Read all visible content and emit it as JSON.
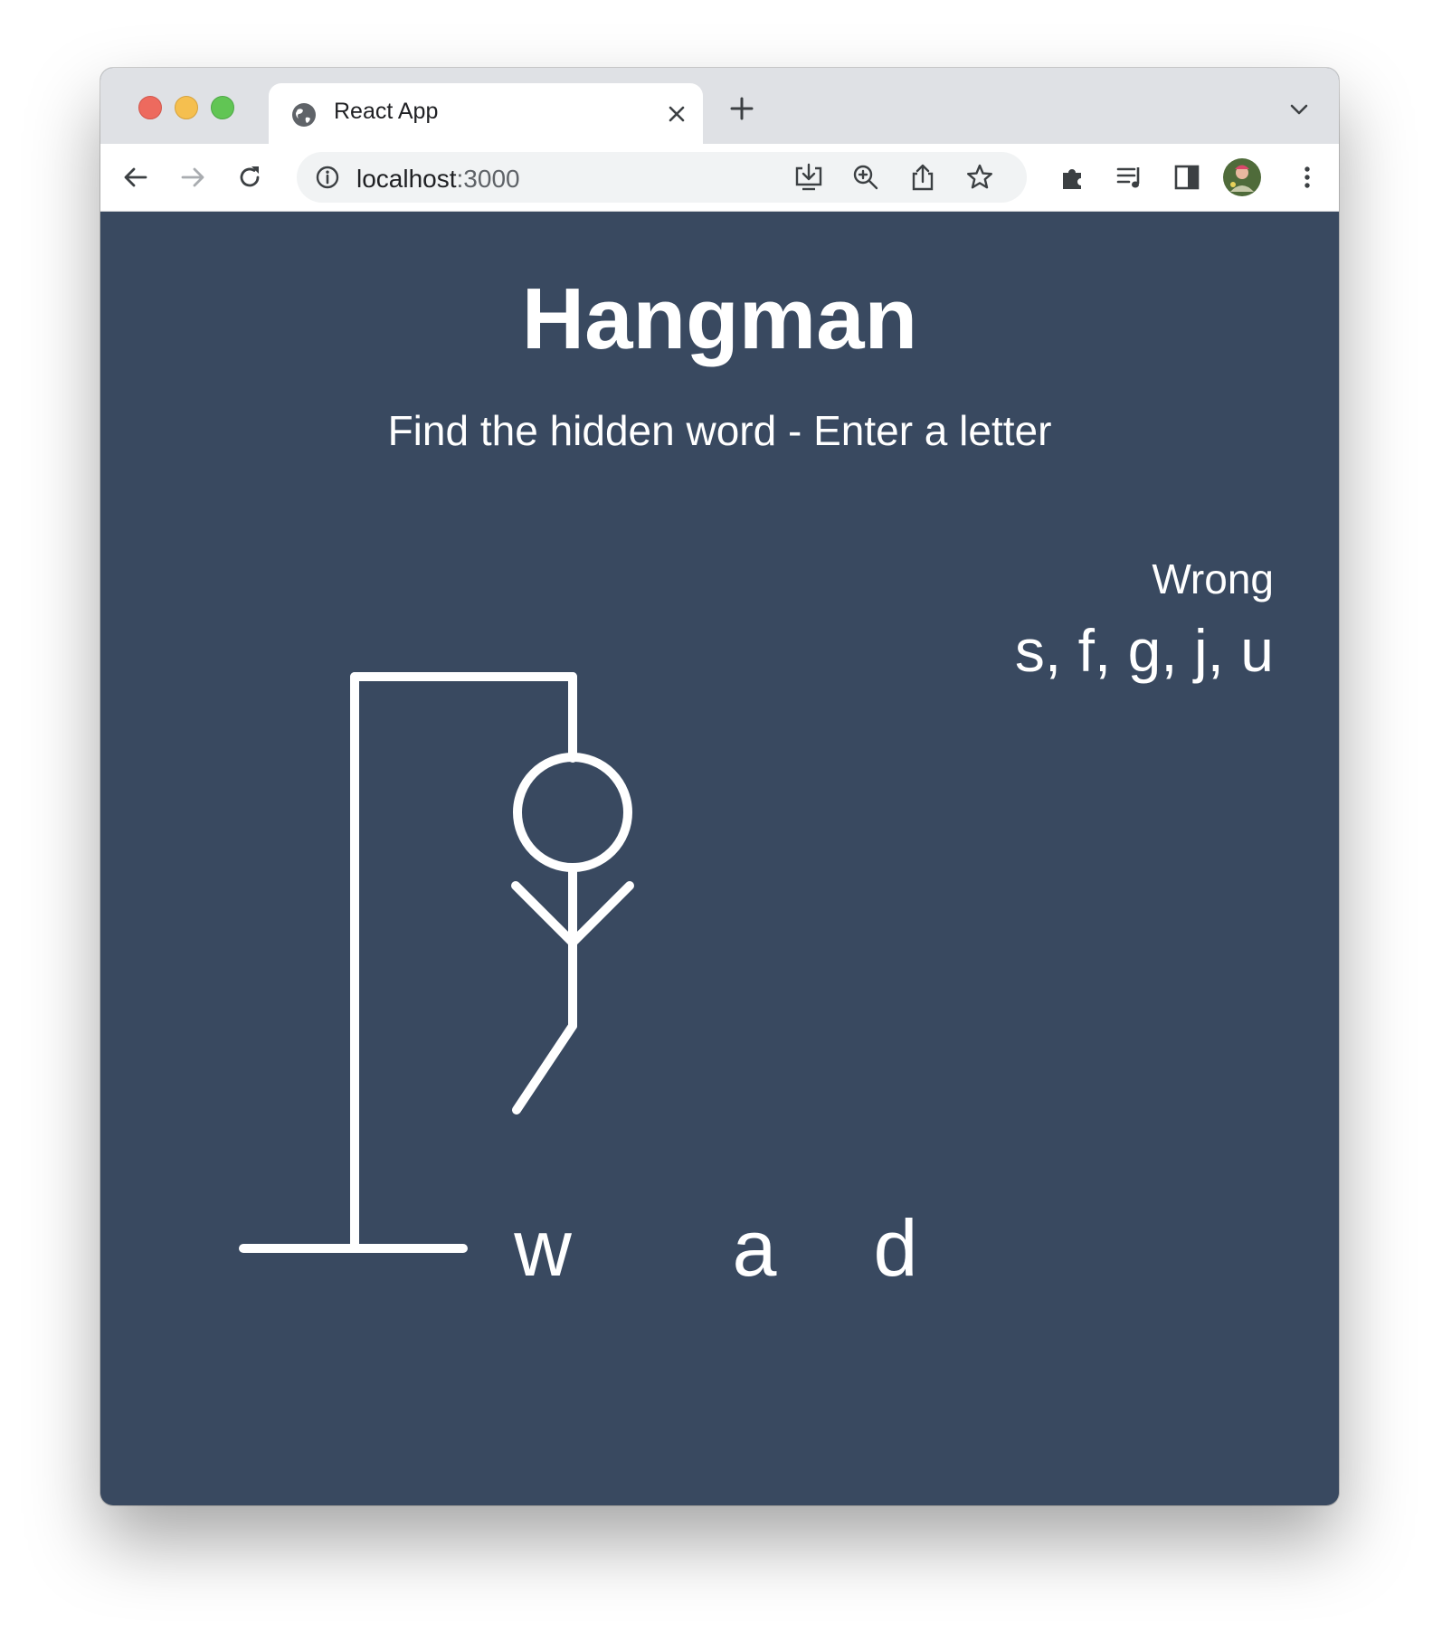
{
  "browser": {
    "tab_title": "React App",
    "url_host": "localhost",
    "url_port": ":3000"
  },
  "game": {
    "title": "Hangman",
    "subtitle": "Find the hidden word - Enter a letter",
    "wrong_label": "Wrong",
    "wrong_letters_display": "s, f, g, j, u",
    "word_letters": [
      "w",
      "",
      "",
      "a",
      "",
      "d"
    ],
    "hangman_parts_shown": [
      "head",
      "body",
      "left-arm",
      "right-arm",
      "left-leg"
    ]
  },
  "colors": {
    "page_background": "#394960",
    "foreground": "#ffffff"
  }
}
